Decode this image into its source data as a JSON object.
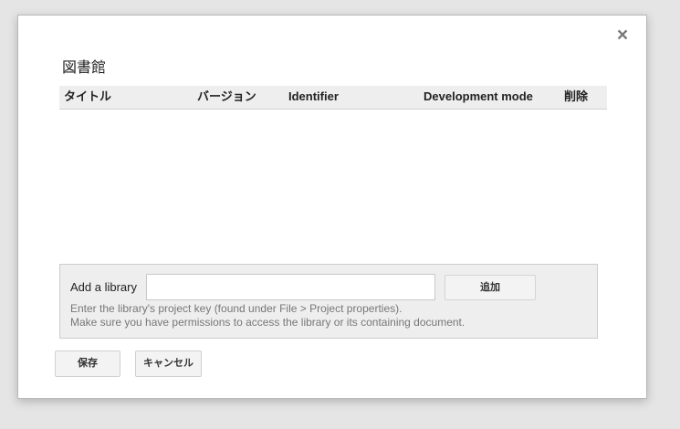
{
  "dialog": {
    "title": "図書館",
    "close_symbol": "×"
  },
  "table": {
    "columns": [
      "タイトル",
      "バージョン",
      "Identifier",
      "Development mode",
      "削除"
    ],
    "rows": []
  },
  "add_library": {
    "label": "Add a library",
    "input_value": "",
    "add_button": "追加",
    "help_line1": "Enter the library's project key (found under File > Project properties).",
    "help_line2": "Make sure you have permissions to access the library or its containing document."
  },
  "footer": {
    "save_label": "保存",
    "cancel_label": "キャンセル"
  },
  "icons": {
    "close": "close-icon"
  }
}
